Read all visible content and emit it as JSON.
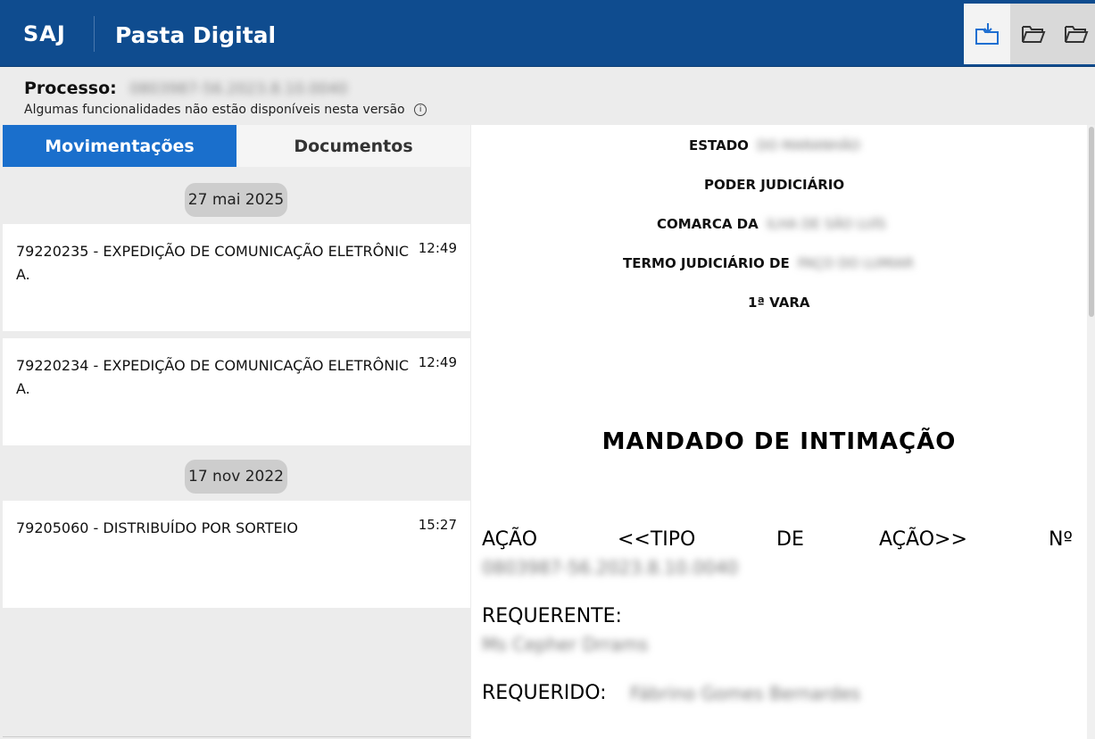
{
  "header": {
    "brand": "SAJ",
    "title": "Pasta Digital",
    "tools": [
      {
        "icon": "folder-download-icon",
        "state": "active"
      },
      {
        "icon": "folder-open-icon",
        "state": "inactive"
      },
      {
        "icon": "folder-open-icon",
        "state": "inactive"
      }
    ]
  },
  "process": {
    "label": "Processo:",
    "number": "0803987-56.2023.8.10.0040",
    "note": "Algumas funcionalidades não estão disponíveis nesta versão",
    "info_icon": "info-icon"
  },
  "tabs": {
    "movimentacoes": "Movimentações",
    "documentos": "Documentos"
  },
  "movements": {
    "group1": {
      "date": "27 mai 2025",
      "items": [
        {
          "text": "79220235 - EXPEDIÇÃO DE COMUNICAÇÃO ELETRÔNICA.",
          "time": "12:49"
        },
        {
          "text": "79220234 - EXPEDIÇÃO DE COMUNICAÇÃO ELETRÔNICA.",
          "time": "12:49"
        }
      ]
    },
    "group2": {
      "date": "17 nov 2022",
      "items": [
        {
          "text": "79205060 - DISTRIBUÍDO POR SORTEIO",
          "time": "15:27"
        }
      ]
    }
  },
  "document": {
    "estado_label": "ESTADO",
    "estado_value": "DO MARANHÃO",
    "poder": "PODER JUDICIÁRIO",
    "comarca_label": "COMARCA DA",
    "comarca_value": "ILHA DE SÃO LUÍS",
    "termo_label": "TERMO JUDICIÁRIO DE",
    "termo_value": "PAÇO DO LUMIAR",
    "vara": "1ª VARA",
    "title": "MANDADO DE INTIMAÇÃO",
    "acao_words": [
      "AÇÃO",
      "<<TIPO",
      "DE",
      "AÇÃO>>",
      "Nº"
    ],
    "acao_number": "0803987-56.2023.8.10.0040",
    "requerente_label": "REQUERENTE:",
    "requerente_value": "Ms Cepher Drrams",
    "requerido_label": "REQUERIDO:",
    "requerido_value": "Fábrino Gomes Bernardes"
  }
}
